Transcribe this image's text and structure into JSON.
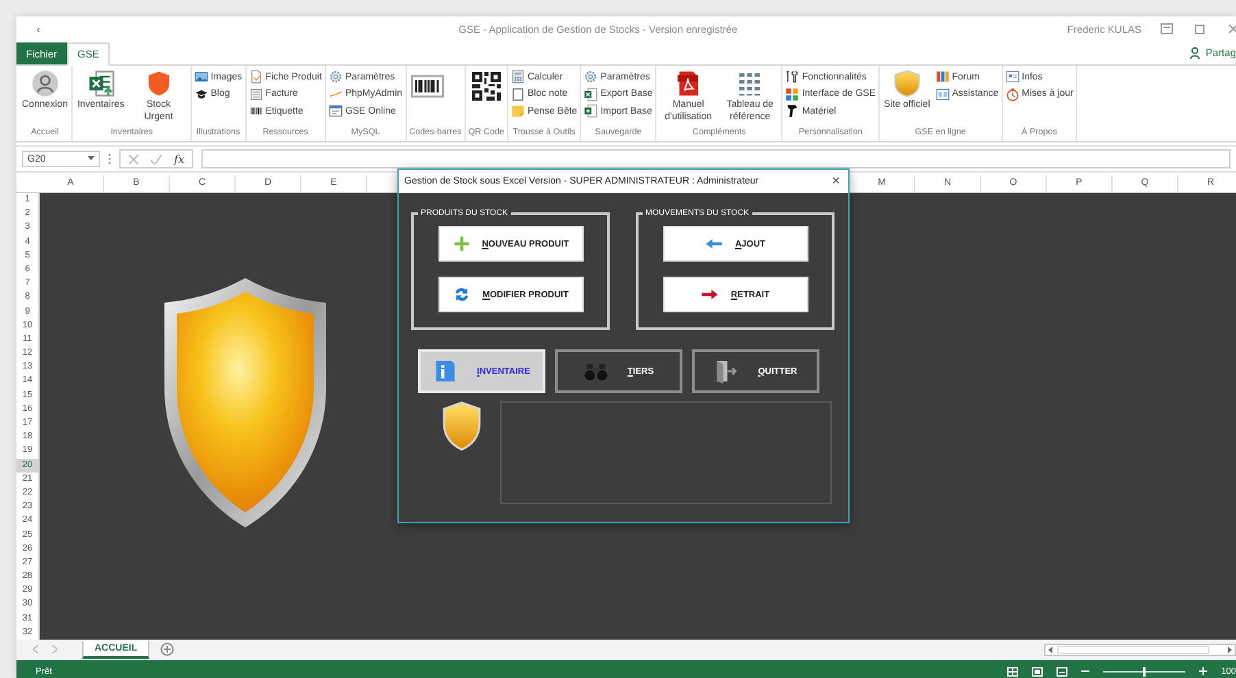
{
  "title_bar": {
    "back": "‹",
    "title": "GSE - Application de Gestion de Stocks - Version enregistrée",
    "user": "Frederic KULAS"
  },
  "ribbon": {
    "tabs": [
      {
        "label": "Fichier",
        "kind": "file",
        "selected": false
      },
      {
        "label": "GSE",
        "kind": "tab",
        "selected": true
      }
    ],
    "share": "Partag",
    "groups": [
      {
        "label": "Accueil",
        "items": [
          {
            "kind": "large",
            "label": "Connexion"
          }
        ]
      },
      {
        "label": "Inventaires",
        "items": [
          {
            "kind": "large",
            "label": "Inventaires"
          },
          {
            "kind": "large",
            "label": "Stock Urgent"
          }
        ]
      },
      {
        "label": "Illustrations",
        "items": [
          {
            "kind": "small",
            "label": "Images"
          },
          {
            "kind": "small",
            "label": "Blog"
          }
        ]
      },
      {
        "label": "Ressources",
        "items": [
          {
            "kind": "small",
            "label": "Fiche Produit"
          },
          {
            "kind": "small",
            "label": "Facture"
          },
          {
            "kind": "small",
            "label": "Etiquette"
          }
        ]
      },
      {
        "label": "MySQL",
        "items": [
          {
            "kind": "small",
            "label": "Paramètres"
          },
          {
            "kind": "small",
            "label": "PhpMyAdmin"
          },
          {
            "kind": "small",
            "label": "GSE Online"
          }
        ]
      },
      {
        "label": "Codes-barres",
        "items": [
          {
            "kind": "large"
          }
        ]
      },
      {
        "label": "QR Code",
        "items": [
          {
            "kind": "large"
          }
        ]
      },
      {
        "label": "Trousse à Outils",
        "items": [
          {
            "kind": "small",
            "label": "Calculer"
          },
          {
            "kind": "small",
            "label": "Bloc note"
          },
          {
            "kind": "small",
            "label": "Pense Bête"
          }
        ]
      },
      {
        "label": "Sauvegarde",
        "items": [
          {
            "kind": "small",
            "label": "Paramètres"
          },
          {
            "kind": "small",
            "label": "Export Base"
          },
          {
            "kind": "small",
            "label": "Import Base"
          }
        ]
      },
      {
        "label": "Compléments",
        "items": [
          {
            "kind": "large",
            "label": "Manuel d'utilisation"
          },
          {
            "kind": "large",
            "label": "Tableau de référence"
          }
        ]
      },
      {
        "label": "Personnalisation",
        "items": [
          {
            "kind": "small",
            "label": "Fonctionnalités"
          },
          {
            "kind": "small",
            "label": "Interface de GSE"
          },
          {
            "kind": "small",
            "label": "Matériel"
          }
        ]
      },
      {
        "label": "GSE en ligne",
        "items": [
          {
            "kind": "large",
            "label": "Site officiel"
          },
          {
            "kind": "small",
            "label": "Forum"
          },
          {
            "kind": "small",
            "label": "Assistance"
          }
        ]
      },
      {
        "label": "À Propos",
        "items": [
          {
            "kind": "small",
            "label": "Infos"
          },
          {
            "kind": "small",
            "label": "Mises à jour"
          }
        ]
      }
    ]
  },
  "formula_bar": {
    "name_box": "G20",
    "function_label": "fx"
  },
  "sheet": {
    "columns_left": [
      "A",
      "B",
      "C",
      "D",
      "E"
    ],
    "columns_right": [
      "M",
      "N",
      "O",
      "P",
      "Q",
      "R"
    ],
    "rows": [
      {
        "label": "1",
        "selected": false
      },
      {
        "label": "2",
        "selected": false
      },
      {
        "label": "3",
        "selected": false
      },
      {
        "label": "4",
        "selected": false
      },
      {
        "label": "5",
        "selected": false
      },
      {
        "label": "6",
        "selected": false
      },
      {
        "label": "7",
        "selected": false
      },
      {
        "label": "8",
        "selected": false
      },
      {
        "label": "9",
        "selected": false
      },
      {
        "label": "10",
        "selected": false
      },
      {
        "label": "11",
        "selected": false
      },
      {
        "label": "12",
        "selected": false
      },
      {
        "label": "13",
        "selected": false
      },
      {
        "label": "14",
        "selected": false
      },
      {
        "label": "15",
        "selected": false
      },
      {
        "label": "16",
        "selected": false
      },
      {
        "label": "17",
        "selected": false
      },
      {
        "label": "18",
        "selected": false
      },
      {
        "label": "19",
        "selected": false
      },
      {
        "label": "20",
        "selected": true
      },
      {
        "label": "21",
        "selected": false
      },
      {
        "label": "22",
        "selected": false
      },
      {
        "label": "23",
        "selected": false
      },
      {
        "label": "24",
        "selected": false
      },
      {
        "label": "25",
        "selected": false
      },
      {
        "label": "26",
        "selected": false
      },
      {
        "label": "27",
        "selected": false
      },
      {
        "label": "28",
        "selected": false
      },
      {
        "label": "29",
        "selected": false
      },
      {
        "label": "30",
        "selected": false
      },
      {
        "label": "31",
        "selected": false
      },
      {
        "label": "32",
        "selected": false
      }
    ]
  },
  "dialog": {
    "title": "Gestion de Stock sous Excel Version - SUPER ADMINISTRATEUR : Administrateur",
    "close": "×",
    "frames": [
      {
        "label": "PRODUITS DU STOCK",
        "buttons": [
          "NOUVEAU PRODUIT",
          "MODIFIER PRODUIT"
        ]
      },
      {
        "label": "MOUVEMENTS DU STOCK",
        "buttons": [
          "AJOUT",
          "RETRAIT"
        ]
      }
    ],
    "nav_buttons": [
      {
        "label": "INVENTAIRE",
        "selected": true
      },
      {
        "label": "TIERS",
        "selected": false
      },
      {
        "label": "QUITTER",
        "selected": false
      }
    ]
  },
  "sheet_tabs": [
    {
      "label": "ACCUEIL",
      "selected": true
    }
  ],
  "status_bar": {
    "text": "Prêt",
    "zoom": {
      "level": 0.5,
      "reading": "100"
    }
  }
}
